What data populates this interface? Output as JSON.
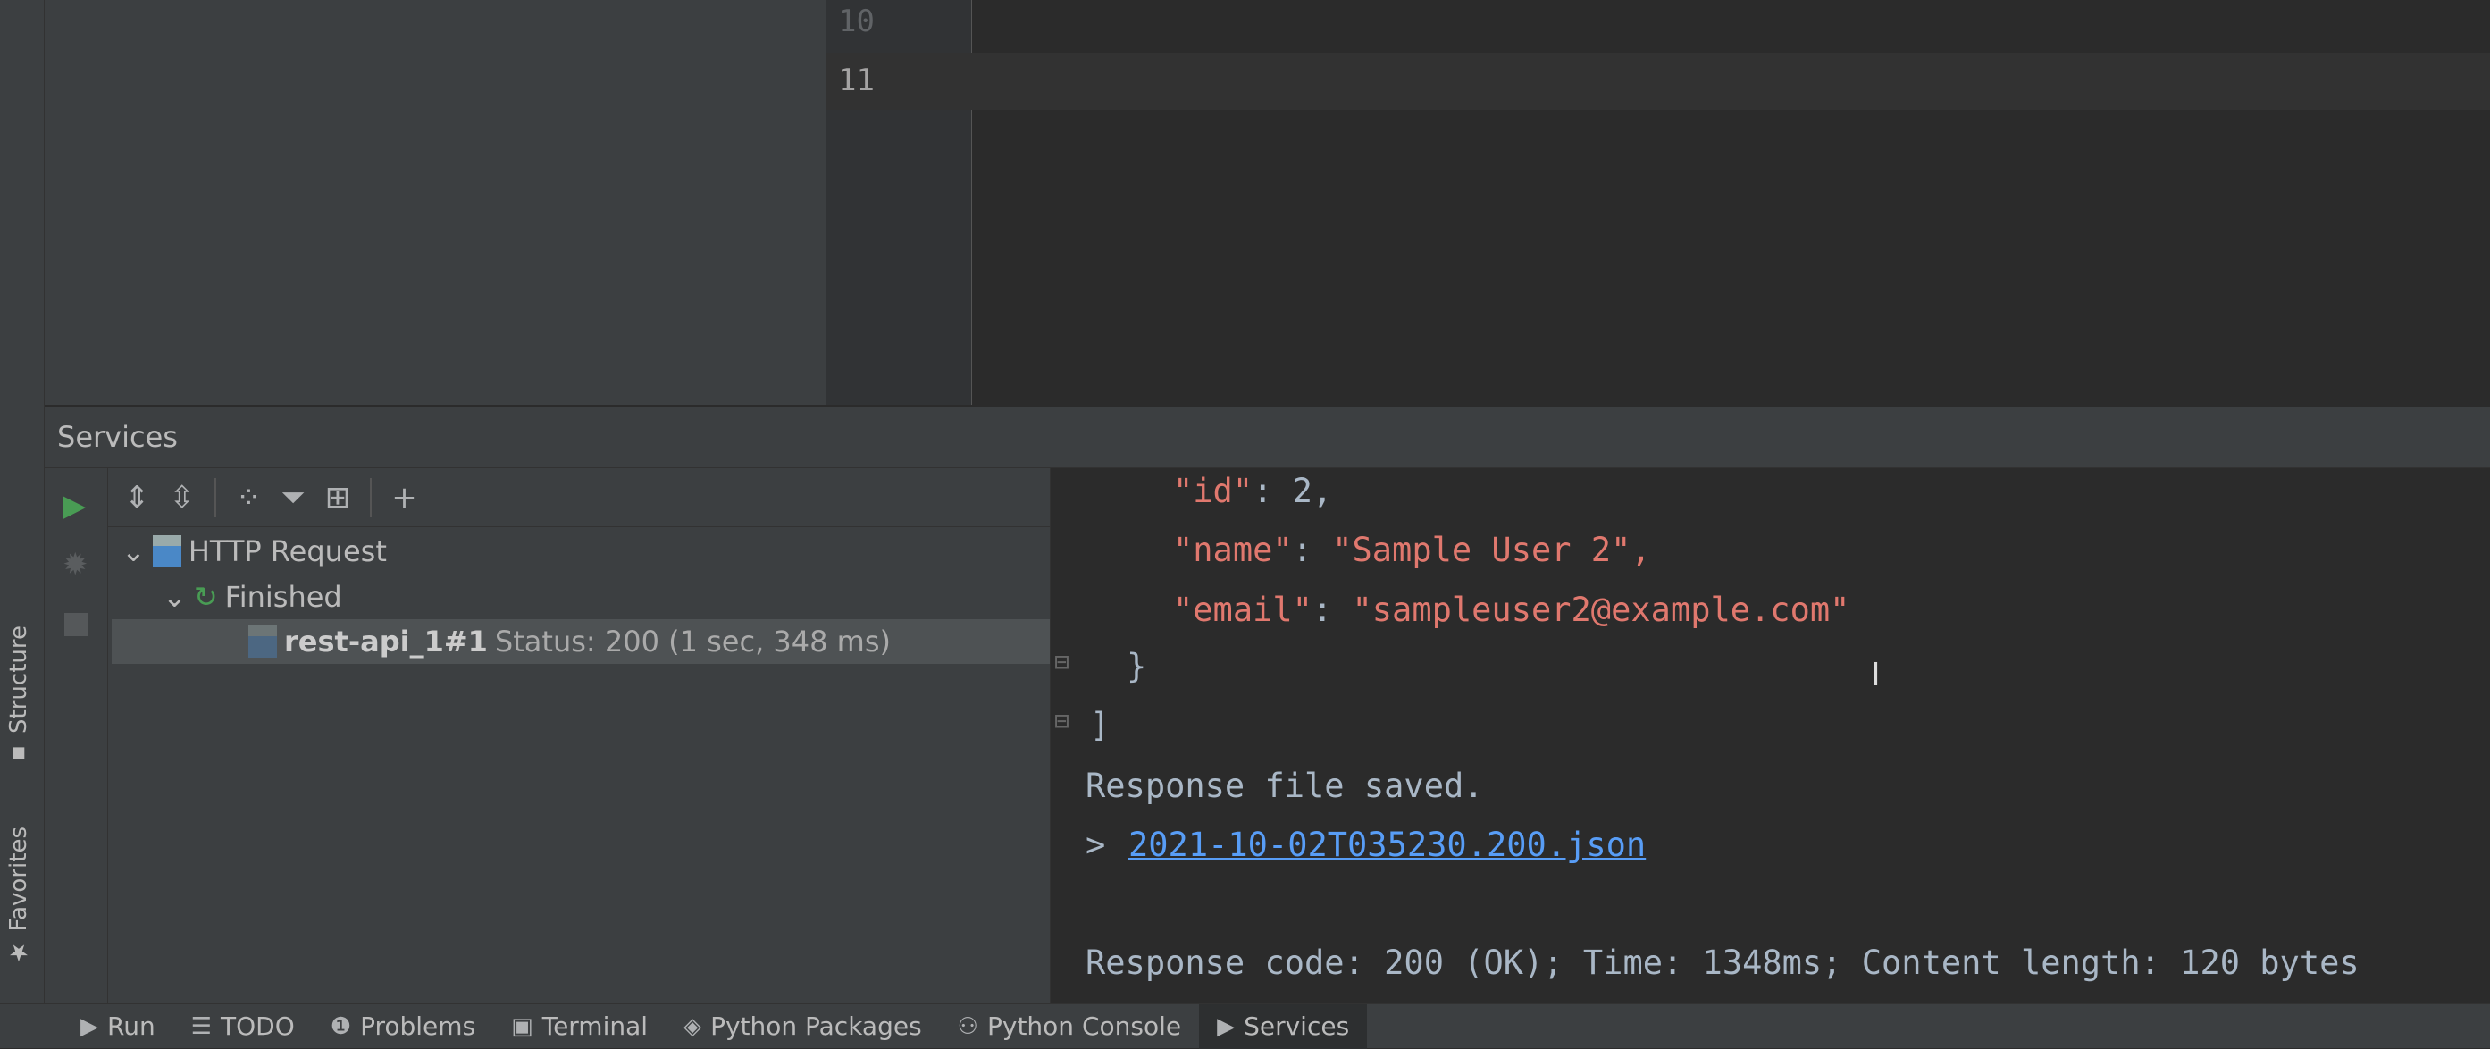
{
  "editor": {
    "line_numbers": [
      "10",
      "11"
    ]
  },
  "left_strip": {
    "tabs": [
      "Structure",
      "Favorites"
    ]
  },
  "services": {
    "title": "Services",
    "tree": [
      {
        "label": "HTTP Request"
      },
      {
        "label": "Finished"
      },
      {
        "name": "rest-api_1#1",
        "status": "Status: 200 (1 sec, 348 ms)"
      }
    ]
  },
  "console": {
    "lines": [
      {
        "key": "\"id\"",
        "value": "2,"
      },
      {
        "key": "\"name\"",
        "value": "\"Sample User 2\","
      },
      {
        "key": "\"email\"",
        "value": "\"sampleuser2@example.com\""
      }
    ],
    "close_brace": "}",
    "close_bracket": "]",
    "saved": "Response file saved.",
    "prompt": ">",
    "file_link": "2021-10-02T035230.200.json",
    "summary": "Response code: 200 (OK); Time: 1348ms; Content length: 120 bytes"
  },
  "bottom_tabs": [
    "Run",
    "TODO",
    "Problems",
    "Terminal",
    "Python Packages",
    "Python Console",
    "Services"
  ],
  "colors": {
    "accent_green": "#499c54",
    "string": "#e0786e",
    "link": "#589df6"
  }
}
